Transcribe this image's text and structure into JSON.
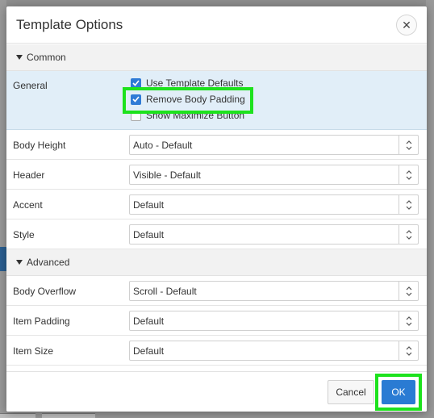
{
  "dialog": {
    "title": "Template Options",
    "close_icon": "close-icon"
  },
  "sections": {
    "common": {
      "label": "Common"
    },
    "advanced": {
      "label": "Advanced"
    }
  },
  "general": {
    "label": "General",
    "options": [
      {
        "label": "Use Template Defaults",
        "checked": true
      },
      {
        "label": "Remove Body Padding",
        "checked": true
      },
      {
        "label": "Show Maximize Button",
        "checked": false
      }
    ]
  },
  "common_fields": [
    {
      "label": "Body Height",
      "value": "Auto - Default"
    },
    {
      "label": "Header",
      "value": "Visible - Default"
    },
    {
      "label": "Accent",
      "value": "Default"
    },
    {
      "label": "Style",
      "value": "Default"
    }
  ],
  "advanced_fields": [
    {
      "label": "Body Overflow",
      "value": "Scroll - Default"
    },
    {
      "label": "Item Padding",
      "value": "Default"
    },
    {
      "label": "Item Size",
      "value": "Default"
    }
  ],
  "footer": {
    "cancel_label": "Cancel",
    "ok_label": "OK"
  },
  "colors": {
    "accent": "#2a7bd3",
    "highlight": "#1de21d",
    "selected_row_bg": "#e1eef8"
  }
}
